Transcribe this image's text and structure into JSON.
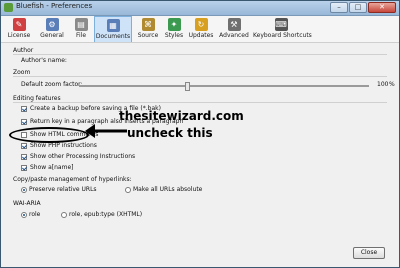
{
  "window": {
    "title": "Bluefish - Preferences",
    "minimize": "–",
    "maximize": "□",
    "close": "✕"
  },
  "toolbar": [
    {
      "label": "License",
      "icon": "license-icon",
      "color": "#d04040"
    },
    {
      "label": "General",
      "icon": "general-icon",
      "color": "#5a7fb8"
    },
    {
      "label": "File",
      "icon": "file-icon",
      "color": "#8a8a8a"
    },
    {
      "label": "Documents",
      "icon": "documents-icon",
      "color": "#5a7fb8"
    },
    {
      "label": "Source",
      "icon": "source-icon",
      "color": "#b08a30"
    },
    {
      "label": "Styles",
      "icon": "styles-icon",
      "color": "#3c9a50"
    },
    {
      "label": "Updates",
      "icon": "updates-icon",
      "color": "#d8a020"
    },
    {
      "label": "Advanced",
      "icon": "advanced-icon",
      "color": "#707070"
    },
    {
      "label": "Keyboard Shortcuts",
      "icon": "keyboard-icon",
      "color": "#555555"
    }
  ],
  "author": {
    "section": "Author",
    "name_label": "Author's name:"
  },
  "zoom": {
    "section": "Zoom",
    "label": "Default zoom factor:",
    "value": "100",
    "unit": "%",
    "level": 0.37
  },
  "editing": {
    "section": "Editing features",
    "options": [
      {
        "label": "Create a backup before saving a file (*.bak)",
        "checked": true
      },
      {
        "label": "Return key in a paragraph also inserts a paragraph",
        "checked": true
      },
      {
        "label": "Show HTML comments",
        "checked": false
      },
      {
        "label": "Show PHP instructions",
        "checked": true
      },
      {
        "label": "Show other Processing Instructions",
        "checked": true
      },
      {
        "label": "Show a[name]",
        "checked": true
      }
    ]
  },
  "copypaste": {
    "section": "Copy/paste management of hyperlinks:",
    "options": [
      {
        "label": "Preserve relative URLs",
        "selected": true
      },
      {
        "label": "Make all URLs absolute",
        "selected": false
      }
    ]
  },
  "waiaria": {
    "section": "WAI-ARIA",
    "options": [
      {
        "label": "role",
        "selected": true
      },
      {
        "label": "role, epub:type (XHTML)",
        "selected": false
      }
    ]
  },
  "buttons": {
    "close": "Close"
  },
  "annotation": {
    "site": "thesitewizard.com",
    "instruction": "uncheck this"
  }
}
